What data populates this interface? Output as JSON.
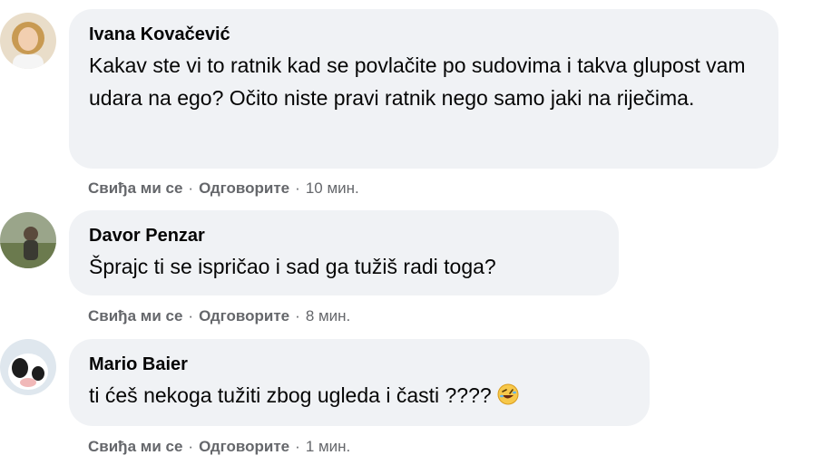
{
  "comments": [
    {
      "author": "Ivana Kovačević",
      "text": "Kakav ste vi to ratnik kad se povlačite po sudovima i takva glupost vam udara na ego? Očito niste pravi ratnik nego samo jaki na riječima.",
      "like": "Свиђа ми се",
      "reply": "Одговорите",
      "separator": "·",
      "time": "10 мин."
    },
    {
      "author": "Davor Penzar",
      "text": "Šprajc ti se ispričao i sad ga tužiš radi toga?",
      "like": "Свиђа ми се",
      "reply": "Одговорите",
      "separator": "·",
      "time": "8 мин."
    },
    {
      "author": "Mario Baier",
      "text": "ti ćeš nekoga tužiti zbog ugleda i časti ????",
      "emoji": "rolling-on-the-floor-laughing-emoji",
      "like": "Свиђа ми се",
      "reply": "Одговорите",
      "separator": "·",
      "time": "1 мин."
    }
  ]
}
